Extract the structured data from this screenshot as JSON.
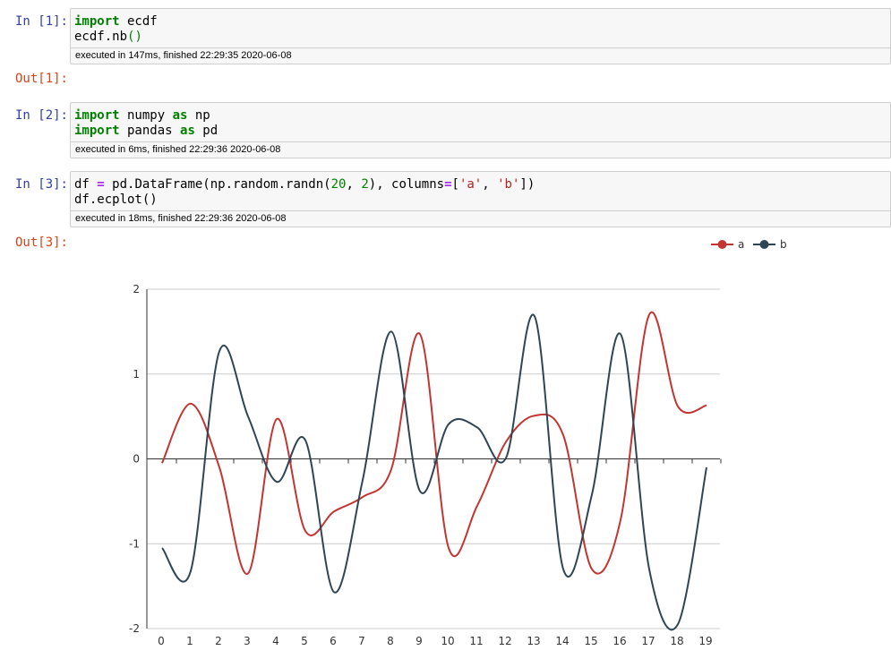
{
  "cells": [
    {
      "in_prompt": "In [1]:",
      "code_lines": [
        [
          {
            "t": "import",
            "c": "kw"
          },
          {
            "t": " ecdf",
            "c": ""
          }
        ],
        [
          {
            "t": "ecdf.nb",
            "c": ""
          },
          {
            "t": "()",
            "c": "paren"
          }
        ]
      ],
      "footer": "executed in 147ms, finished 22:29:35 2020-06-08",
      "out_prompt": "Out[1]:"
    },
    {
      "in_prompt": "In [2]:",
      "code_lines": [
        [
          {
            "t": "import",
            "c": "kw"
          },
          {
            "t": " numpy ",
            "c": ""
          },
          {
            "t": "as",
            "c": "kw"
          },
          {
            "t": " np",
            "c": ""
          }
        ],
        [
          {
            "t": "import",
            "c": "kw"
          },
          {
            "t": " pandas ",
            "c": ""
          },
          {
            "t": "as",
            "c": "kw"
          },
          {
            "t": " pd",
            "c": ""
          }
        ]
      ],
      "footer": "executed in 6ms, finished 22:29:36 2020-06-08"
    },
    {
      "in_prompt": "In [3]:",
      "code_lines": [
        [
          {
            "t": "df ",
            "c": ""
          },
          {
            "t": "=",
            "c": "op"
          },
          {
            "t": " pd.DataFrame(np.random.randn(",
            "c": ""
          },
          {
            "t": "20",
            "c": "num"
          },
          {
            "t": ", ",
            "c": ""
          },
          {
            "t": "2",
            "c": "num"
          },
          {
            "t": "), columns",
            "c": ""
          },
          {
            "t": "=",
            "c": "op"
          },
          {
            "t": "[",
            "c": ""
          },
          {
            "t": "'a'",
            "c": "str"
          },
          {
            "t": ", ",
            "c": ""
          },
          {
            "t": "'b'",
            "c": "str"
          },
          {
            "t": "])",
            "c": ""
          }
        ],
        [
          {
            "t": "df.ecplot()",
            "c": ""
          }
        ]
      ],
      "footer": "executed in 18ms, finished 22:29:36 2020-06-08",
      "out_prompt": "Out[3]:"
    }
  ],
  "chart_data": {
    "type": "line",
    "smooth": true,
    "x": [
      0,
      1,
      2,
      3,
      4,
      5,
      6,
      7,
      8,
      9,
      10,
      11,
      12,
      13,
      14,
      15,
      16,
      17,
      18,
      19
    ],
    "ylim": [
      -2,
      2
    ],
    "yticks": [
      -2,
      -1,
      0,
      1,
      2
    ],
    "grid": true,
    "legend": "top-right",
    "series": [
      {
        "name": "a",
        "color": "#c23531",
        "values": [
          -0.05,
          0.65,
          -0.1,
          -1.35,
          0.47,
          -0.85,
          -0.62,
          -0.45,
          -0.12,
          1.47,
          -1.05,
          -0.55,
          0.2,
          0.51,
          0.28,
          -1.3,
          -0.72,
          1.7,
          0.62,
          0.63
        ]
      },
      {
        "name": "b",
        "color": "#2f4554",
        "values": [
          -1.05,
          -1.32,
          1.27,
          0.5,
          -0.27,
          0.22,
          -1.57,
          -0.25,
          1.5,
          -0.38,
          0.41,
          0.37,
          0.01,
          1.68,
          -1.3,
          -0.42,
          1.47,
          -1.3,
          -1.95,
          -0.1
        ]
      }
    ]
  }
}
